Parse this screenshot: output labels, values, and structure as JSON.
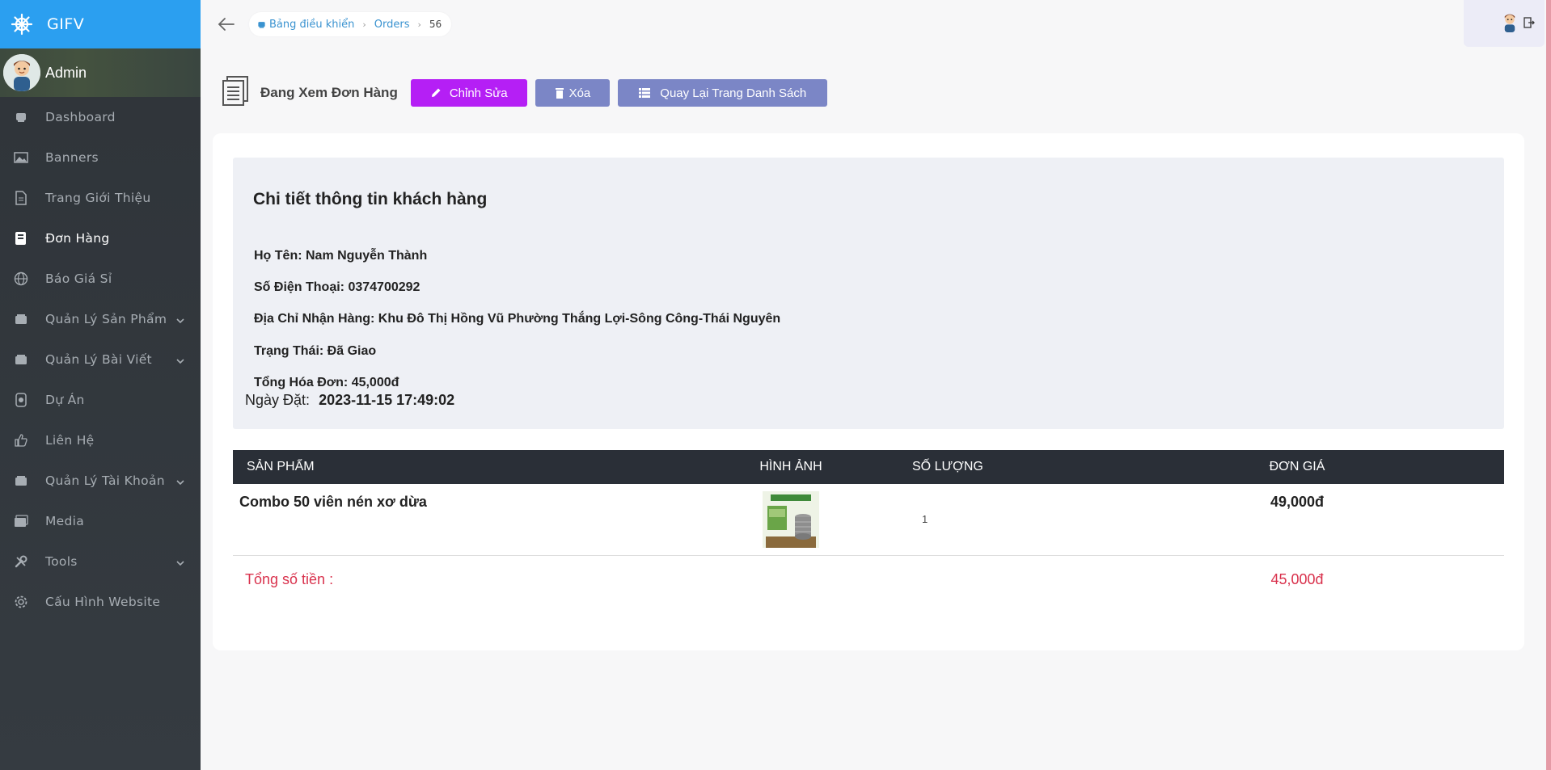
{
  "brand": {
    "name": "GIFV",
    "color": "#2b9ff0"
  },
  "user": {
    "name": "Admin"
  },
  "sidebar": {
    "items": [
      {
        "label": "Dashboard",
        "icon": "dashboard-icon"
      },
      {
        "label": "Banners",
        "icon": "image-icon"
      },
      {
        "label": "Trang Giới Thiệu",
        "icon": "document-icon"
      },
      {
        "label": "Đơn Hàng",
        "icon": "book-icon",
        "active": true
      },
      {
        "label": "Báo Giá Sỉ",
        "icon": "globe-icon"
      },
      {
        "label": "Quản Lý Sản Phẩm",
        "icon": "folder-icon",
        "expandable": true
      },
      {
        "label": "Quản Lý Bài Viết",
        "icon": "folder-icon",
        "expandable": true
      },
      {
        "label": "Dự Án",
        "icon": "project-icon"
      },
      {
        "label": "Liên Hệ",
        "icon": "thumbs-up-icon"
      },
      {
        "label": "Quản Lý Tài Khoản",
        "icon": "folder-icon",
        "expandable": true
      },
      {
        "label": "Media",
        "icon": "media-icon"
      },
      {
        "label": "Tools",
        "icon": "tools-icon",
        "expandable": true
      },
      {
        "label": "Cấu Hình Website",
        "icon": "gear-icon"
      }
    ]
  },
  "breadcrumb": {
    "home": "Bảng điều khiển",
    "section": "Orders",
    "current": "56"
  },
  "page": {
    "title": "Đang Xem Đơn Hàng",
    "edit_label": "Chỉnh Sửa",
    "delete_label": "Xóa",
    "back_label": "Quay Lại Trang Danh Sách"
  },
  "customer": {
    "heading": "Chi tiết thông tin khách hàng",
    "name": "Họ Tên: Nam Nguyễn Thành",
    "phone": "Số Điện Thoại: 0374700292",
    "address": "Địa Chỉ Nhận Hàng: Khu Đô Thị Hồng Vũ Phường Thắng Lợi-Sông Công-Thái Nguyên",
    "status": "Trạng Thái: Đã Giao",
    "total": "Tổng Hóa Đơn: 45,000đ",
    "date_label": "Ngày Đặt:",
    "date_value": "2023-11-15 17:49:02"
  },
  "table": {
    "headers": [
      "SẢN PHẨM",
      "HÌNH ẢNH",
      "SỐ LƯỢNG",
      "ĐƠN GIÁ"
    ],
    "rows": [
      {
        "product": "Combo 50 viên nén xơ dừa",
        "quantity": "1",
        "price": "49,000đ"
      }
    ],
    "total_label": "Tổng số tiền :",
    "total_value": "45,000đ"
  },
  "colors": {
    "edit": "#b51ff5",
    "secondary": "#7b86c6",
    "table_head": "#2a2f37",
    "total_text": "#d9324d"
  }
}
